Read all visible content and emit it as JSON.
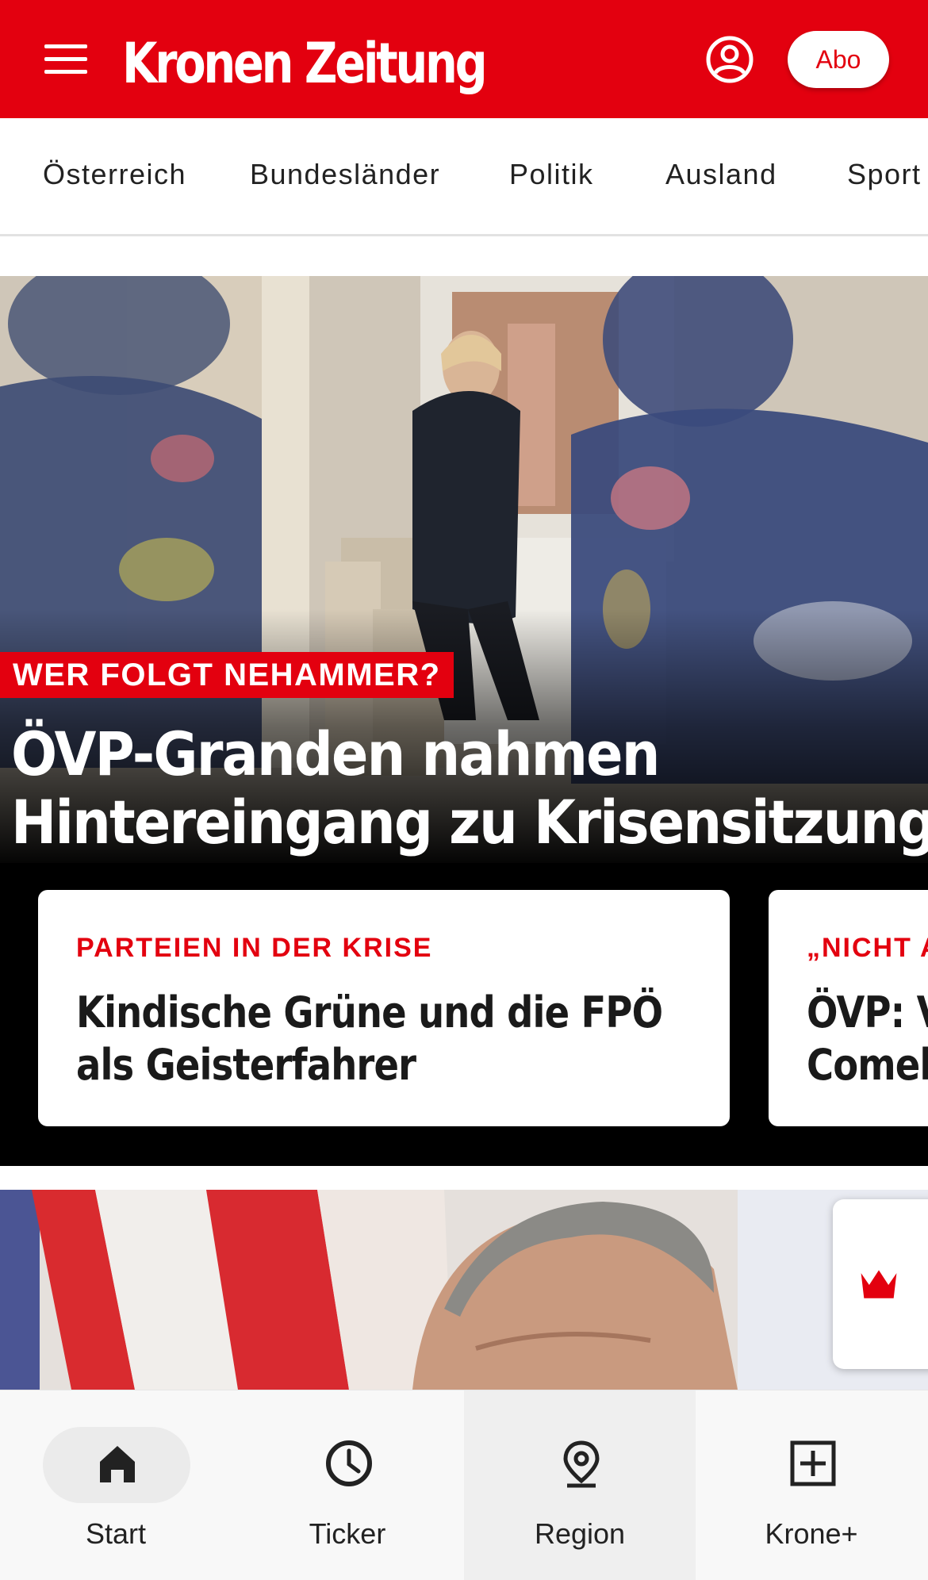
{
  "header": {
    "logo_text": "Kronen Zeitung",
    "abo_label": "Abo",
    "brand_color": "#e3000f",
    "menu_icon": "hamburger-menu-icon",
    "account_icon": "account-circle-icon"
  },
  "categories": [
    "Österreich",
    "Bundesländer",
    "Politik",
    "Ausland",
    "Sport"
  ],
  "hero": {
    "kicker": "WER FOLGT NEHAMMER?",
    "title_line1": "ÖVP-Granden nahmen",
    "title_line2": "Hintereingang zu Krisensitzung"
  },
  "cards": [
    {
      "kicker": "PARTEIEN IN DER KRISE",
      "title_line1": "Kindische Grüne und die FPÖ",
      "title_line2": "als Geisterfahrer"
    },
    {
      "kicker": "„NICHT A",
      "title_line1": "ÖVP: V",
      "title_line2": "Comeb"
    }
  ],
  "krone_button_icon": "crown-icon",
  "bottom_nav": {
    "items": [
      {
        "label": "Start",
        "icon": "home-icon"
      },
      {
        "label": "Ticker",
        "icon": "clock-icon"
      },
      {
        "label": "Region",
        "icon": "location-pin-icon"
      },
      {
        "label": "Krone+",
        "icon": "plus-box-icon"
      }
    ]
  }
}
